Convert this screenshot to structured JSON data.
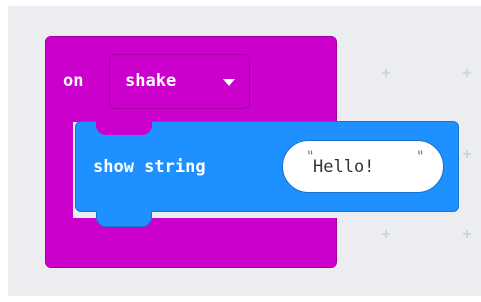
{
  "event_block": {
    "keyword": "on",
    "gesture_value": "shake",
    "icons": {
      "dropdown": "triangle-down-icon"
    },
    "color": "#cc00cc"
  },
  "statement_block": {
    "label": "show string",
    "value": "Hello!",
    "open_quote": "\"",
    "close_quote": "\"",
    "color": "#1e90ff"
  },
  "workspace": {
    "background": "#ecedf1"
  }
}
